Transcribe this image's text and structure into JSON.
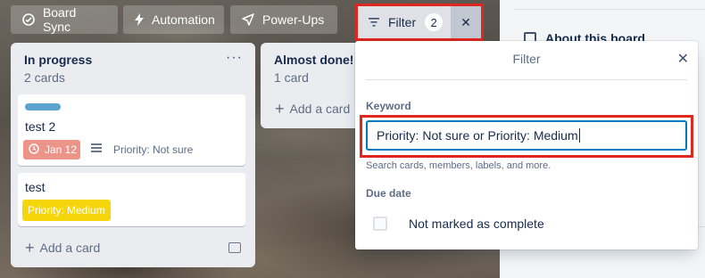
{
  "toolbar": {
    "board_sync": "Board Sync",
    "automation": "Automation",
    "power_ups": "Power-Ups",
    "filter_label": "Filter",
    "filter_count": "2",
    "filter_clear": "✕"
  },
  "lists": [
    {
      "title": "In progress",
      "count": "2 cards",
      "menu": "···",
      "cards": [
        {
          "title": "test 2",
          "label_color": "#5ba4cf",
          "due": "Jan 12",
          "priority_text": "Priority: Not sure"
        },
        {
          "title": "test",
          "priority_badge": "Priority: Medium",
          "priority_color": "#f5d60a"
        }
      ],
      "add_card": "Add a card"
    },
    {
      "title": "Almost done!",
      "count": "1 card",
      "add_card": "Add a card"
    }
  ],
  "sidebar": {
    "about": "About this board"
  },
  "filter_popover": {
    "title": "Filter",
    "close": "✕",
    "keyword_label": "Keyword",
    "keyword_value": "Priority: Not sure or Priority: Medium",
    "keyword_hint": "Search cards, members, labels, and more.",
    "due_label": "Due date",
    "due_option": "Not marked as complete"
  },
  "colors": {
    "highlight": "#e0261d",
    "input_focus": "#0079bf",
    "due_badge": "#ec9488"
  }
}
